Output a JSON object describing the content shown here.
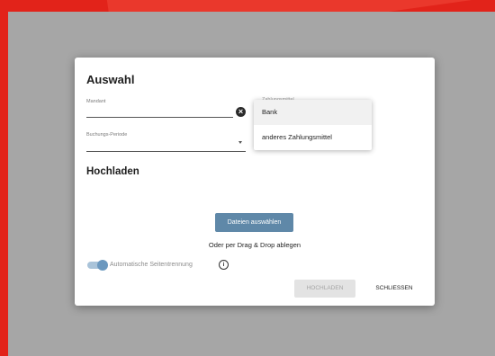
{
  "dialog": {
    "selection_title": "Auswahl",
    "client_label": "Mandant",
    "period_label": "Buchungs-Periode",
    "hidden_label": "Zahlungsmittel",
    "dropdown_options": [
      "Bank",
      "anderes Zahlungsmittel"
    ],
    "selected_option": "Bank",
    "upload_title": "Hochladen",
    "choose_files_label": "Dateien auswählen",
    "drag_drop_text": "Oder per Drag & Drop ablegen",
    "toggle_label": "Automatische Seitentrennung",
    "toggle_on": true,
    "upload_button_label": "HOCHLADEN",
    "close_button_label": "SCHLIESSEN"
  },
  "icons": {
    "clear": "close-circle-icon",
    "dropdown": "chevron-down-icon",
    "info": "info-icon"
  },
  "colors": {
    "brand_red": "#e2231a",
    "primary_button": "#5f88a8",
    "toggle_active": "#6b98bf",
    "disabled_button": "#e3e3e3"
  }
}
